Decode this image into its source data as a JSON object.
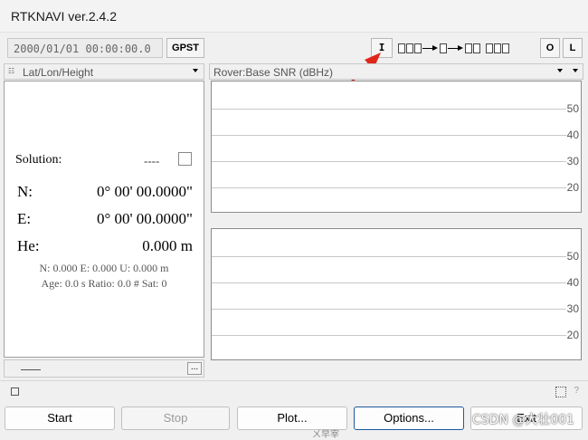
{
  "window": {
    "title": "RTKNAVI ver.2.4.2"
  },
  "toolbar": {
    "time": "2000/01/01 00:00:00.0",
    "time_system": "GPST",
    "input_label": "I",
    "output_label": "O",
    "log_label": "L"
  },
  "left_panel": {
    "selector": "Lat/Lon/Height",
    "solution_label": "Solution:",
    "solution_status": "----",
    "rows": [
      {
        "label": "N:",
        "value": "0° 00' 00.0000\""
      },
      {
        "label": "E:",
        "value": "0° 00' 00.0000\""
      },
      {
        "label": "He:",
        "value": "0.000 m"
      }
    ],
    "std_line": "N: 0.000 E: 0.000 U: 0.000 m",
    "age_line": "Age: 0.0 s Ratio: 0.0 # Sat: 0",
    "more_button": "..."
  },
  "right_panel": {
    "selector": "Rover:Base SNR (dBHz)",
    "plot1_ticks": [
      "50",
      "40",
      "30",
      "20"
    ],
    "plot2_ticks": [
      "50",
      "40",
      "30",
      "20"
    ]
  },
  "status": {
    "help": "?"
  },
  "buttons": {
    "start": "Start",
    "stop": "Stop",
    "plot": "Plot...",
    "options": "Options...",
    "exit": "Exit"
  },
  "annotation": {
    "marker": "1",
    "color": "#e0261b"
  },
  "watermark": "CSDN @大壮001",
  "underlying_text": "ㄨ早宰"
}
